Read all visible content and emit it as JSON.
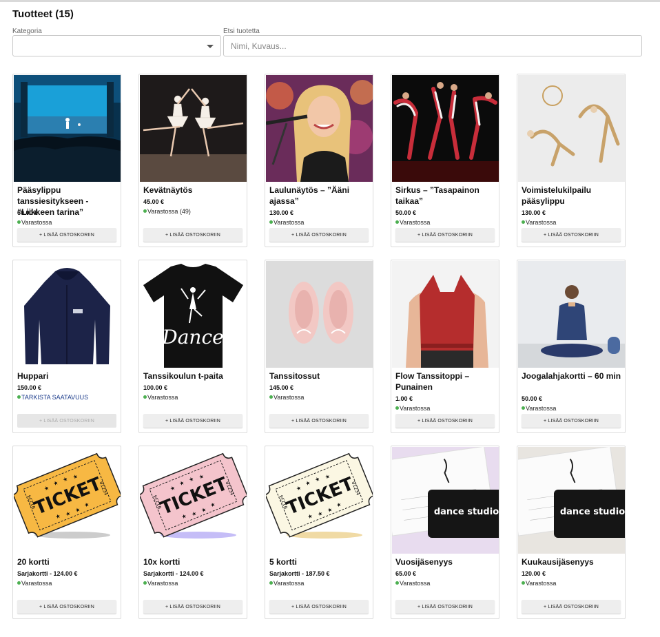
{
  "page": {
    "title": "Tuotteet (15)"
  },
  "filters": {
    "category_label": "Kategoria",
    "category_value": "",
    "search_label": "Etsi tuotetta",
    "search_placeholder": "Nimi, Kuvaus..."
  },
  "colors": {
    "stock_dot": "#4caf50",
    "check_text": "#1a3a8a",
    "button_bg": "#eeeeee"
  },
  "products": [
    {
      "name": "Pääsylippu tanssiesitykseen - “Liikkeen tarina”",
      "price": "60.00 €",
      "stock": "Varastossa",
      "button": "+ LISÄÄ OSTOSKORIIN",
      "image": "stage-photo"
    },
    {
      "name": "Kevätnäytös",
      "price": "45.00 €",
      "stock": "Varastossa (49)",
      "button": "+ LISÄÄ OSTOSKORIIN",
      "image": "ballet-photo"
    },
    {
      "name": "Laulunäytös – ”Ääni ajassa”",
      "price": "130.00 €",
      "stock": "Varastossa",
      "button": "+ LISÄÄ OSTOSKORIIN",
      "image": "singer-photo"
    },
    {
      "name": "Sirkus – ”Tasapainon taikaa”",
      "price": "50.00 €",
      "stock": "Varastossa",
      "button": "+ LISÄÄ OSTOSKORIIN",
      "image": "circus-photo"
    },
    {
      "name": "Voimistelukilpailu pääsylippu",
      "price": "130.00 €",
      "stock": "Varastossa",
      "button": "+ LISÄÄ OSTOSKORIIN",
      "image": "gymnastics-photo"
    },
    {
      "name": "Huppari",
      "price": "150.00 €",
      "stock": "TARKISTA SAATAVUUS",
      "button": "+ LISÄÄ OSTOSKORIIN",
      "image": "hoodie-photo",
      "disabled": true
    },
    {
      "name": "Tanssikoulun t-paita",
      "price": "100.00 €",
      "stock": "Varastossa",
      "button": "+ LISÄÄ OSTOSKORIIN",
      "image": "tshirt-photo",
      "tshirt_text": "Dance"
    },
    {
      "name": "Tanssitossut",
      "price": "145.00 €",
      "stock": "Varastossa",
      "button": "+ LISÄÄ OSTOSKORIIN",
      "image": "shoes-photo"
    },
    {
      "name": "Flow Tanssitoppi – Punainen",
      "price": "1.00 €",
      "stock": "Varastossa",
      "button": "+ LISÄÄ OSTOSKORIIN",
      "image": "top-photo"
    },
    {
      "name": "Joogalahjakortti – 60 min",
      "price": "50.00 €",
      "stock": "Varastossa",
      "button": "+ LISÄÄ OSTOSKORIIN",
      "image": "yoga-photo"
    },
    {
      "name": "20 kortti",
      "price": "Sarjakortti - 124.00 €",
      "stock": "Varastossa",
      "button": "+ LISÄÄ OSTOSKORIIN",
      "image": "ticket-yellow",
      "ticket_text": "TICKET",
      "ticket_number": "01234"
    },
    {
      "name": "10x kortti",
      "price": "Sarjakortti - 124.00 €",
      "stock": "Varastossa",
      "button": "+ LISÄÄ OSTOSKORIIN",
      "image": "ticket-pink",
      "ticket_text": "TICKET",
      "ticket_number": "01234"
    },
    {
      "name": "5 kortti",
      "price": "Sarjakortti - 187.50 €",
      "stock": "Varastossa",
      "button": "+ LISÄÄ OSTOSKORIIN",
      "image": "ticket-cream",
      "ticket_text": "TICKET",
      "ticket_number": "01234"
    },
    {
      "name": "Vuosijäsenyys",
      "price": "65.00 €",
      "stock": "Varastossa",
      "button": "+ LISÄÄ OSTOSKORIIN",
      "image": "membership-card-pink",
      "card_text": "the dance studio leeds"
    },
    {
      "name": "Kuukausijäsenyys",
      "price": "120.00 €",
      "stock": "Varastossa",
      "button": "+ LISÄÄ OSTOSKORIIN",
      "image": "membership-card-beige",
      "card_text": "the dance studio leeds"
    }
  ]
}
